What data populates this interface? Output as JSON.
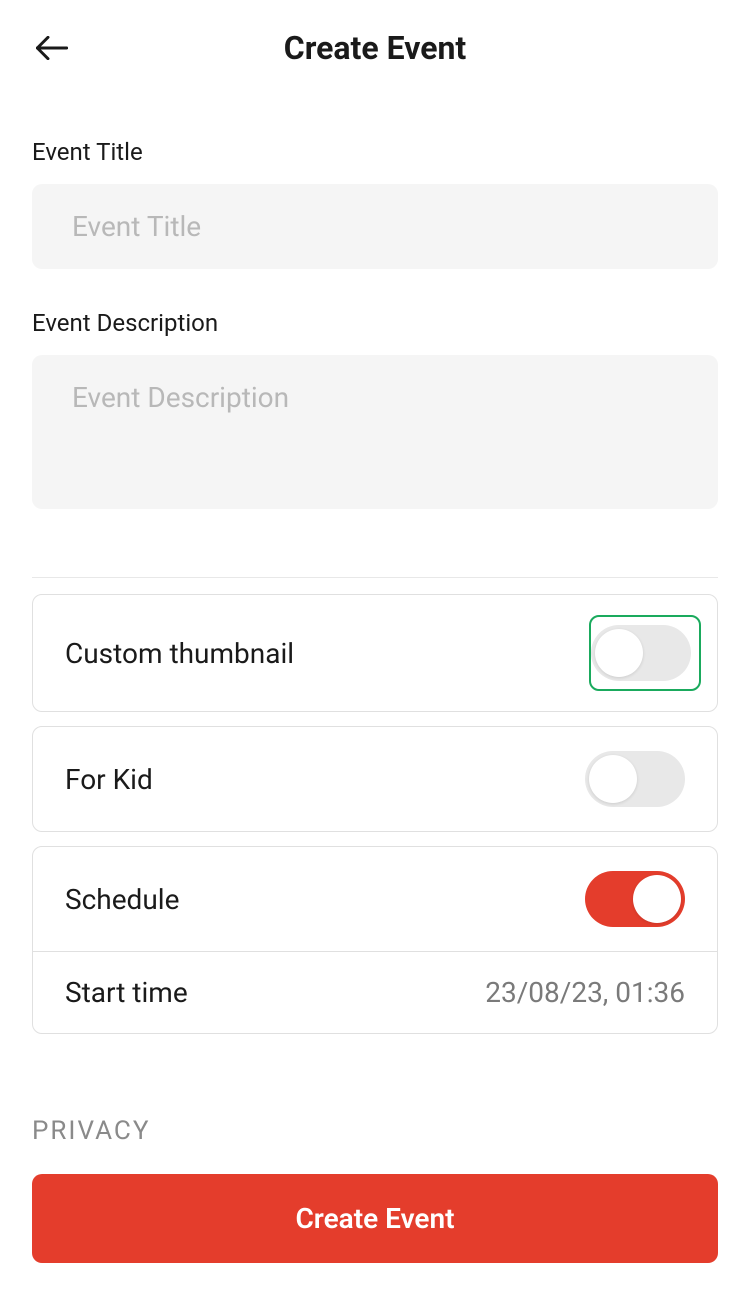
{
  "header": {
    "title": "Create Event"
  },
  "form": {
    "event_title": {
      "label": "Event Title",
      "placeholder": "Event Title",
      "value": ""
    },
    "event_description": {
      "label": "Event Description",
      "placeholder": "Event Description",
      "value": ""
    }
  },
  "toggles": {
    "custom_thumbnail": {
      "label": "Custom thumbnail",
      "value": false
    },
    "for_kid": {
      "label": "For Kid",
      "value": false
    },
    "schedule": {
      "label": "Schedule",
      "value": true
    }
  },
  "schedule": {
    "start_time_label": "Start time",
    "start_time_value": "23/08/23, 01:36"
  },
  "sections": {
    "privacy": "PRIVACY"
  },
  "button": {
    "create": "Create Event"
  }
}
